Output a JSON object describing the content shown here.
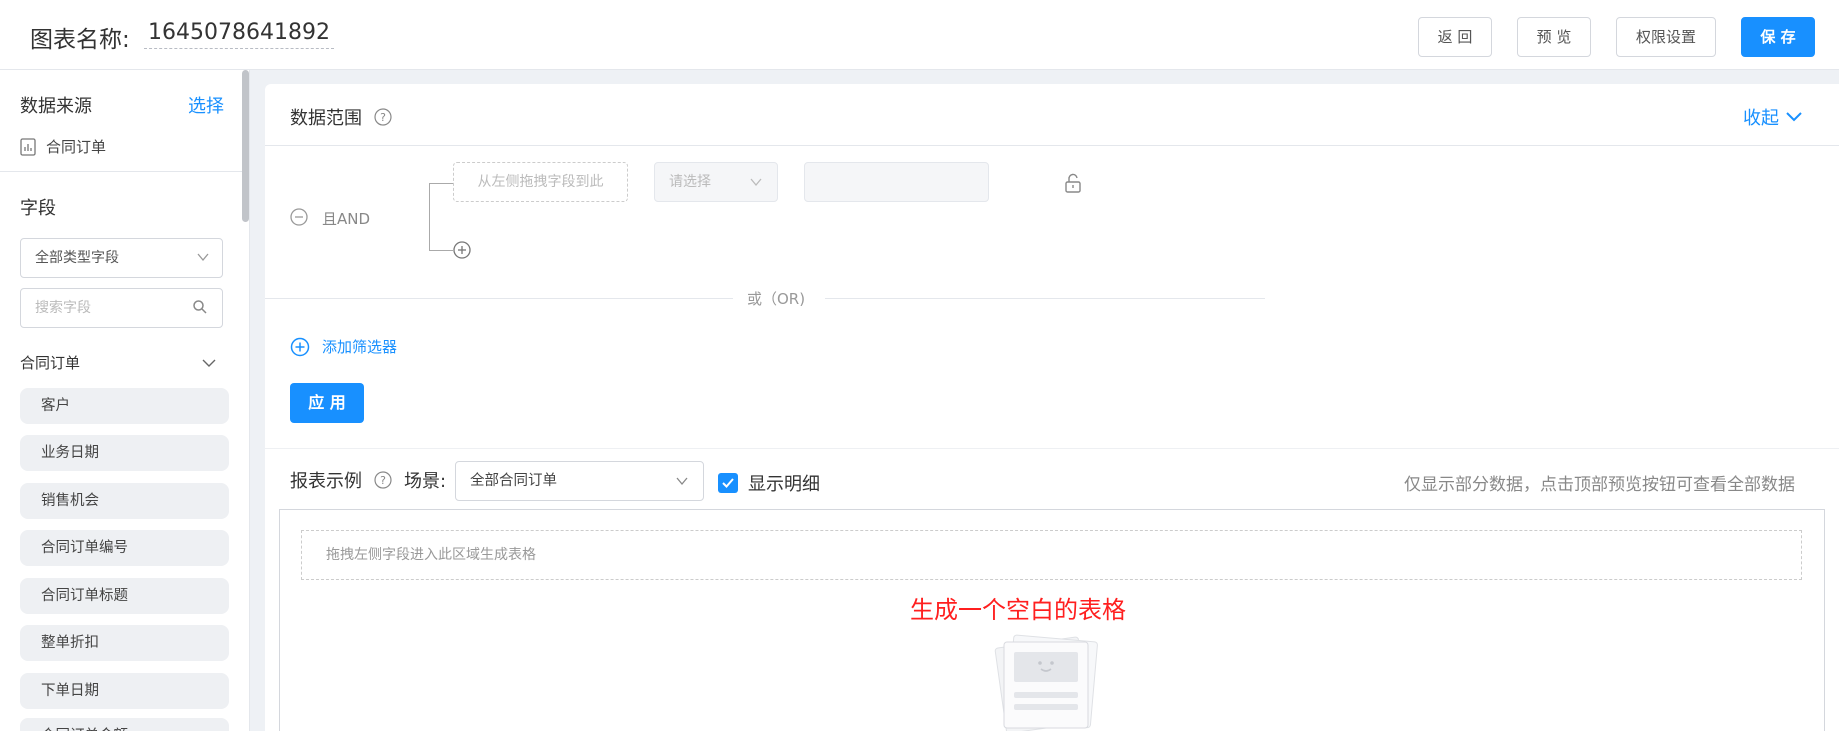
{
  "header": {
    "title_label": "图表名称:",
    "title_value": "1645078641892",
    "buttons": {
      "back": "返 回",
      "preview": "预 览",
      "permissions": "权限设置",
      "save": "保 存"
    }
  },
  "sidebar": {
    "data_source_title": "数据来源",
    "select_link": "选择",
    "source_name": "合同订单",
    "fields_title": "字段",
    "type_filter": "全部类型字段",
    "search_placeholder": "搜索字段",
    "group_name": "合同订单",
    "fields": [
      "客户",
      "业务日期",
      "销售机会",
      "合同订单编号",
      "合同订单标题",
      "整单折扣",
      "下单日期",
      "合同订单金额"
    ]
  },
  "range": {
    "title": "数据范围",
    "collapse": "收起",
    "and_label": "且AND",
    "drop_placeholder": "从左侧拖拽字段到此",
    "select_placeholder": "请选择",
    "or_label": "或（OR)",
    "add_filter": "添加筛选器",
    "apply": "应 用"
  },
  "report": {
    "title": "报表示例",
    "scene_label": "场景:",
    "scene_value": "全部合同订单",
    "show_detail": "显示明细",
    "show_detail_checked": true,
    "hint": "仅显示部分数据，点击顶部预览按钮可查看全部数据",
    "drop_zone": "拖拽左侧字段进入此区域生成表格",
    "empty_note": "生成一个空白的表格"
  },
  "colors": {
    "primary": "#1890ff",
    "accent_red": "#ff1f1f"
  }
}
